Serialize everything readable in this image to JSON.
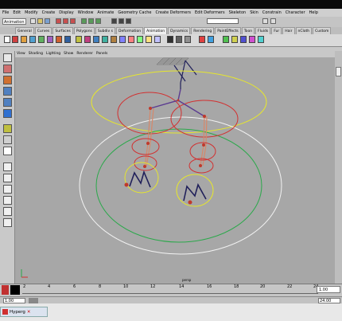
{
  "menubar": [
    "File",
    "Edit",
    "Modify",
    "Create",
    "Display",
    "Window",
    "Animate",
    "Geometry Cache",
    "Create Deformers",
    "Edit Deformers",
    "Skeleton",
    "Skin",
    "Constrain",
    "Character",
    "Help"
  ],
  "status_line": {
    "menu_set": "Animation"
  },
  "shelf_tabs": [
    "General",
    "Curves",
    "Surfaces",
    "Polygons",
    "Subdiv s",
    "Deformation",
    "Animation",
    "Dynamics",
    "Rendering",
    "PaintEffects",
    "Toon",
    "Fluids",
    "Fur",
    "Hair",
    "nCloth",
    "Custom"
  ],
  "active_shelf_tab": "Animation",
  "panel_menu": [
    "View",
    "Shading",
    "Lighting",
    "Show",
    "Renderer",
    "Panels"
  ],
  "viewport": {
    "camera_label": "persp"
  },
  "timeline": {
    "ticks": [
      "2",
      "4",
      "6",
      "8",
      "10",
      "12",
      "14",
      "16",
      "18",
      "20",
      "22",
      "24"
    ],
    "current_frame": "1.00"
  },
  "range": {
    "start": "1.00",
    "end": "24.00"
  },
  "taskbar": {
    "app_label": "Hyperg"
  },
  "colors": {
    "yellow": "#e6e62d",
    "red": "#d23030",
    "green": "#2aa84a",
    "white": "#f2f2f2",
    "bone": "#d6886a",
    "joint": "#c0392b"
  }
}
